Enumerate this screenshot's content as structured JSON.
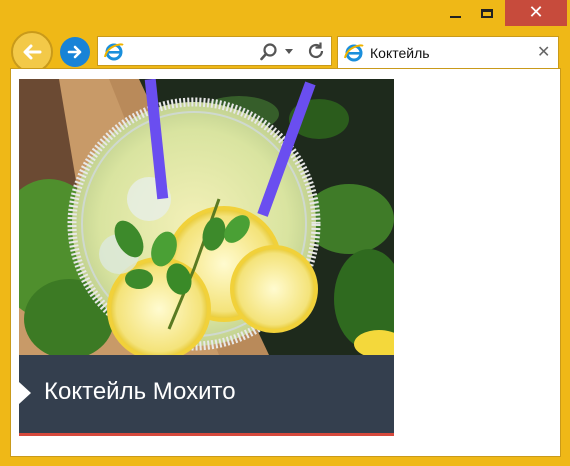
{
  "browser": {
    "tab_title": "Коктейль",
    "address_value": "",
    "controls": {
      "minimize": "minimize",
      "maximize": "maximize",
      "close": "close"
    }
  },
  "page": {
    "card": {
      "caption": "Коктейль Мохито",
      "image_subject": "mojito drink with lemon slices, mint and purple straws",
      "accent_color": "#d6493c",
      "caption_bg": "#343f4e"
    }
  },
  "icons": [
    "back-arrow-icon",
    "forward-arrow-icon",
    "ie-logo-icon",
    "search-icon",
    "dropdown-arrow-icon",
    "refresh-icon",
    "close-icon"
  ]
}
